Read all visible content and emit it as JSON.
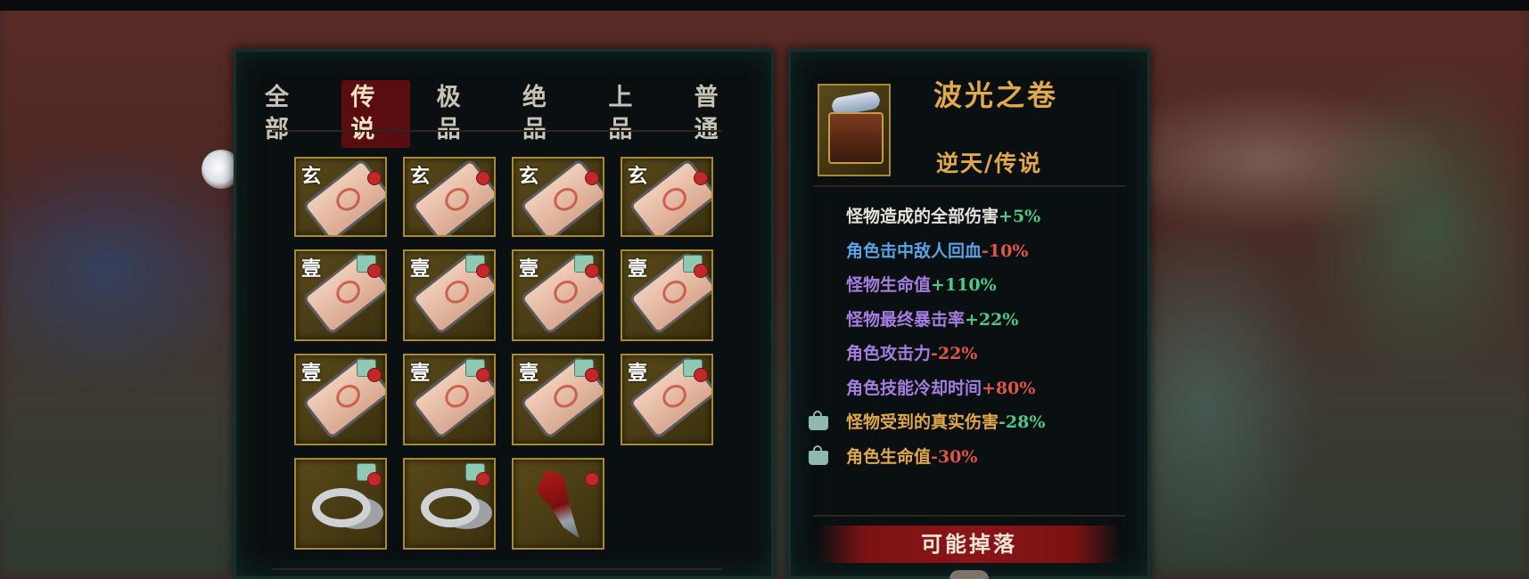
{
  "tabs": [
    {
      "label": "全部",
      "active": false
    },
    {
      "label": "传说",
      "active": true
    },
    {
      "label": "极品",
      "active": false
    },
    {
      "label": "绝品",
      "active": false
    },
    {
      "label": "上品",
      "active": false
    },
    {
      "label": "普通",
      "active": false
    }
  ],
  "inventory": {
    "items": [
      {
        "type": "scroll",
        "rank_label": "玄"
      },
      {
        "type": "scroll",
        "rank_label": "玄"
      },
      {
        "type": "scroll",
        "rank_label": "玄"
      },
      {
        "type": "scroll",
        "rank_label": "玄"
      },
      {
        "type": "scroll",
        "rank_label": "壹"
      },
      {
        "type": "scroll",
        "rank_label": "壹"
      },
      {
        "type": "scroll",
        "rank_label": "壹"
      },
      {
        "type": "scroll",
        "rank_label": "壹"
      },
      {
        "type": "scroll",
        "rank_label": "壹"
      },
      {
        "type": "scroll",
        "rank_label": "壹"
      },
      {
        "type": "scroll",
        "rank_label": "壹"
      },
      {
        "type": "scroll",
        "rank_label": "壹"
      },
      {
        "type": "ring",
        "rank_label": ""
      },
      {
        "type": "ring",
        "rank_label": ""
      },
      {
        "type": "sword",
        "rank_label": ""
      }
    ]
  },
  "detail": {
    "name": "波光之卷",
    "grade": "逆天/传说",
    "icon": "scroll-chest-icon",
    "stats": [
      {
        "label": "怪物造成的全部伤害",
        "value": "+5%",
        "label_color": "#e6e2da",
        "value_color": "#4cc98a",
        "locked": false
      },
      {
        "label": "角色击中敌人回血",
        "value": "-10%",
        "label_color": "#5aa2e6",
        "value_color": "#e0554a",
        "locked": false
      },
      {
        "label": "怪物生命值",
        "value": "+110%",
        "label_color": "#a57ee0",
        "value_color": "#4cc98a",
        "locked": false
      },
      {
        "label": "怪物最终暴击率",
        "value": "+22%",
        "label_color": "#a57ee0",
        "value_color": "#4cc98a",
        "locked": false
      },
      {
        "label": "角色攻击力",
        "value": "-22%",
        "label_color": "#a57ee0",
        "value_color": "#e0554a",
        "locked": false
      },
      {
        "label": "角色技能冷却时间",
        "value": "+80%",
        "label_color": "#a57ee0",
        "value_color": "#e0554a",
        "locked": false
      },
      {
        "label": "怪物受到的真实伤害",
        "value": "-28%",
        "label_color": "#e0a84a",
        "value_color": "#4cc98a",
        "locked": true
      },
      {
        "label": "角色生命值",
        "value": "-30%",
        "label_color": "#e0a84a",
        "value_color": "#e0554a",
        "locked": true
      }
    ],
    "drop_title": "可能掉落"
  },
  "colors": {
    "panel_bg": "#0a1011",
    "slot_border": "#a88a32",
    "tab_active_bg": "#5a0d10",
    "accent_gold": "#e0a84a"
  }
}
